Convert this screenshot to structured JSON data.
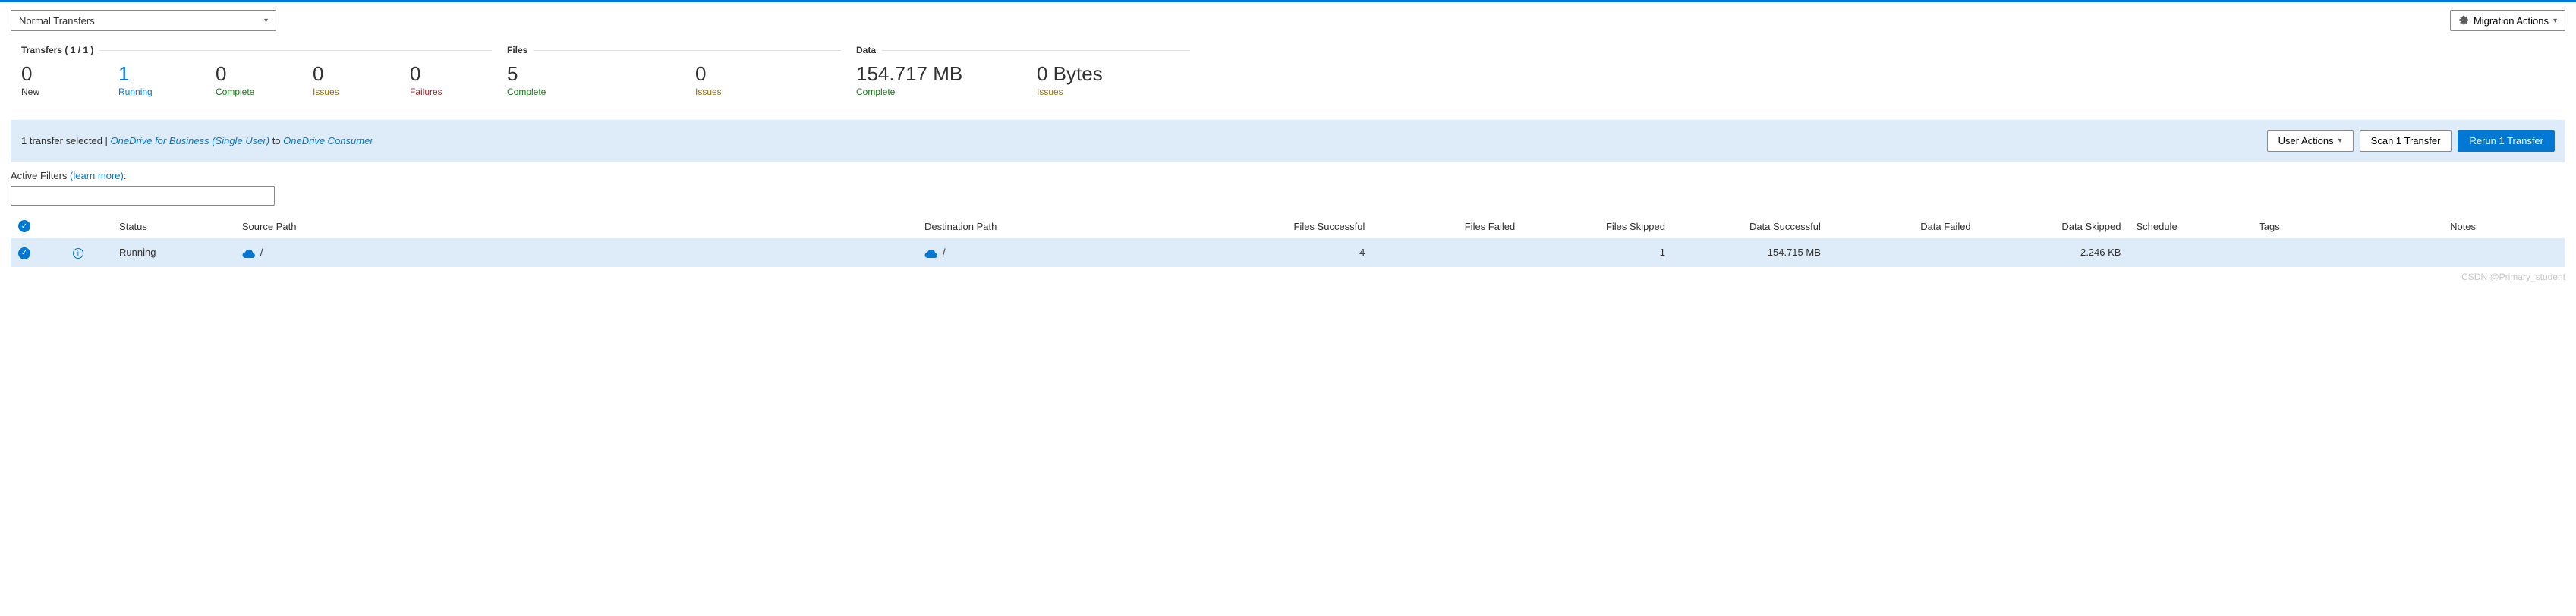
{
  "header": {
    "transfer_select_value": "Normal Transfers",
    "migration_actions_label": "Migration Actions"
  },
  "stats": {
    "transfers": {
      "title": "Transfers ( 1 / 1 )",
      "new": {
        "value": "0",
        "label": "New"
      },
      "running": {
        "value": "1",
        "label": "Running"
      },
      "complete": {
        "value": "0",
        "label": "Complete"
      },
      "issues": {
        "value": "0",
        "label": "Issues"
      },
      "failures": {
        "value": "0",
        "label": "Failures"
      }
    },
    "files": {
      "title": "Files",
      "complete": {
        "value": "5",
        "label": "Complete"
      },
      "issues": {
        "value": "0",
        "label": "Issues"
      }
    },
    "data": {
      "title": "Data",
      "complete": {
        "value": "154.717 MB",
        "label": "Complete"
      },
      "issues": {
        "value": "0 Bytes",
        "label": "Issues"
      }
    }
  },
  "selection_bar": {
    "prefix": "1 transfer selected | ",
    "source": "OneDrive for Business (Single User)",
    "middle": " to ",
    "dest": "OneDrive Consumer",
    "user_actions_label": "User Actions",
    "scan_label": "Scan 1 Transfer",
    "rerun_label": "Rerun 1 Transfer"
  },
  "filters": {
    "label_prefix": "Active Filters ",
    "learn_more": "(learn more)",
    "suffix": ":"
  },
  "table": {
    "headers": {
      "status": "Status",
      "source_path": "Source Path",
      "destination_path": "Destination Path",
      "files_successful": "Files Successful",
      "files_failed": "Files Failed",
      "files_skipped": "Files Skipped",
      "data_successful": "Data Successful",
      "data_failed": "Data Failed",
      "data_skipped": "Data Skipped",
      "schedule": "Schedule",
      "tags": "Tags",
      "notes": "Notes"
    },
    "rows": [
      {
        "status": "Running",
        "source_path": "/",
        "destination_path": "/",
        "files_successful": "4",
        "files_failed": "",
        "files_skipped": "1",
        "data_successful": "154.715 MB",
        "data_failed": "",
        "data_skipped": "2.246 KB",
        "schedule": "",
        "tags": "",
        "notes": ""
      }
    ]
  },
  "watermark": "CSDN @Primary_student"
}
